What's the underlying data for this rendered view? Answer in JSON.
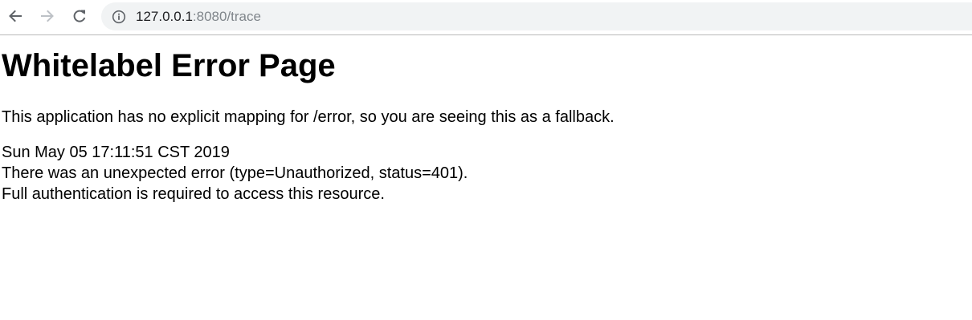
{
  "browser": {
    "url_host": "127.0.0.1",
    "url_rest": ":8080/trace",
    "icons": {
      "back": "arrow-left-icon",
      "forward": "arrow-right-icon",
      "reload": "reload-icon",
      "info": "info-icon"
    },
    "colors": {
      "omnibox_bg": "#f1f3f4",
      "url_host": "#202124",
      "url_path": "#80868b",
      "icon_active": "#5f6368",
      "icon_disabled": "#bdc1c6"
    }
  },
  "page": {
    "title": "Whitelabel Error Page",
    "description": "This application has no explicit mapping for /error, so you are seeing this as a fallback.",
    "timestamp": "Sun May 05 17:11:51 CST 2019",
    "error_line": "There was an unexpected error (type=Unauthorized, status=401).",
    "message": "Full authentication is required to access this resource."
  }
}
